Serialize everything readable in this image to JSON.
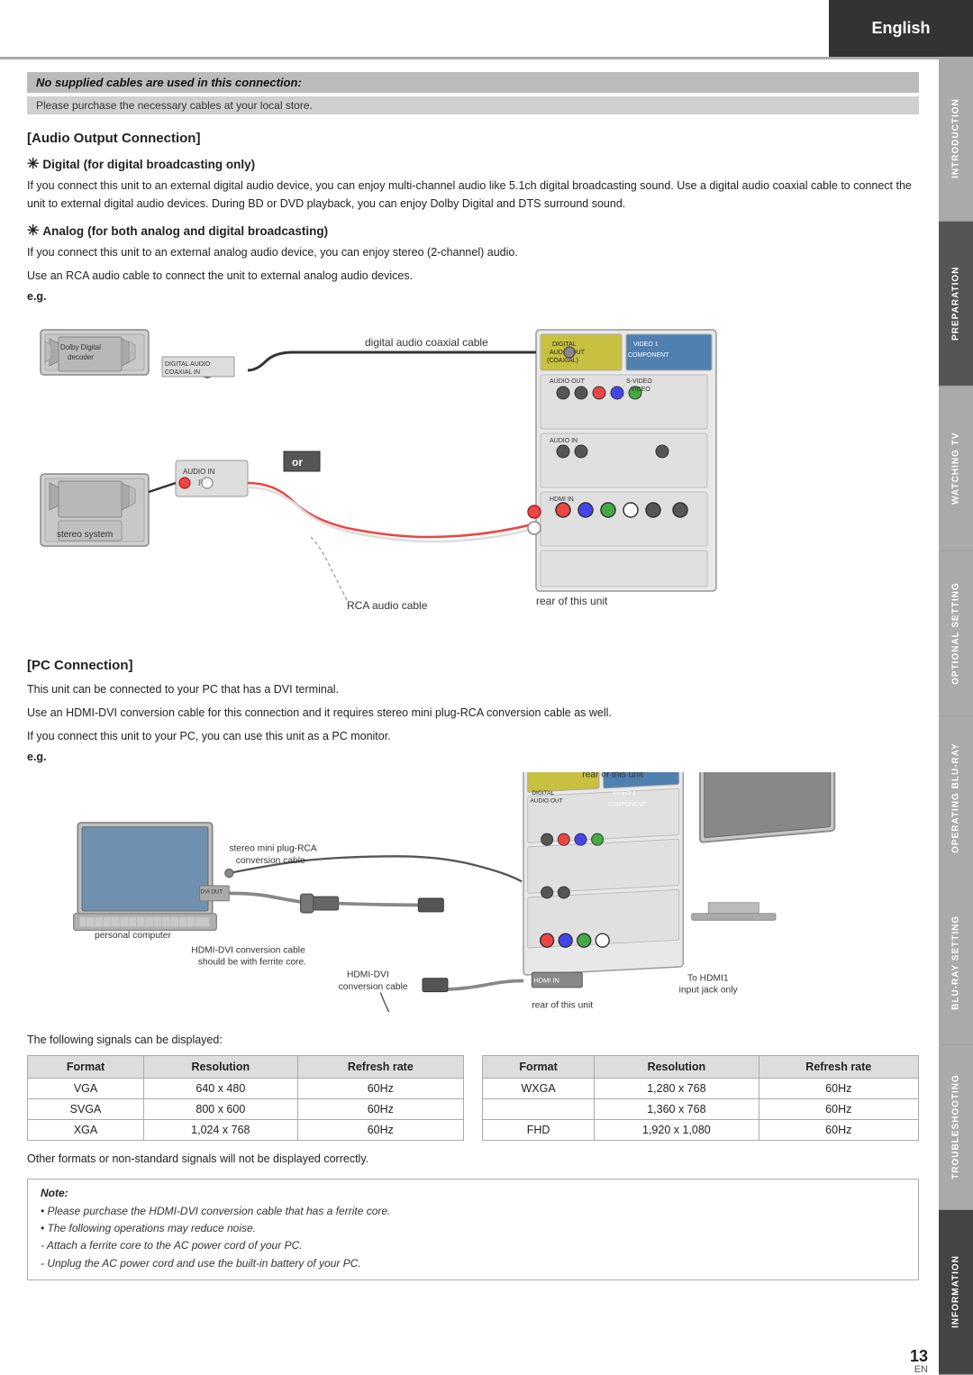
{
  "header": {
    "language": "English"
  },
  "sidebar": {
    "tabs": [
      {
        "label": "INTRODUCTION"
      },
      {
        "label": "PREPARATION",
        "active": true
      },
      {
        "label": "WATCHING TV"
      },
      {
        "label": "OPTIONAL SETTING"
      },
      {
        "label": "OPERATING BLU-RAY"
      },
      {
        "label": "BLU-RAY SETTING"
      },
      {
        "label": "TROUBLESHOOTING"
      },
      {
        "label": "INFORMATION"
      }
    ]
  },
  "notice": {
    "title": "No supplied cables are used in this connection:",
    "subtitle": "Please purchase the necessary cables at your local store."
  },
  "audio_section": {
    "heading": "[Audio Output Connection]",
    "digital": {
      "label": "Digital",
      "sublabel": "(for digital broadcasting only)",
      "body": "If you connect this unit to an external digital audio device, you can enjoy multi-channel audio like 5.1ch digital broadcasting sound. Use a digital audio coaxial cable to connect the unit to external digital audio devices. During BD or DVD playback, you can enjoy Dolby Digital and DTS surround sound."
    },
    "analog": {
      "label": "Analog",
      "sublabel": "(for both analog and digital broadcasting)",
      "body1": "If you connect this unit to an external analog audio device, you can enjoy stereo (2-channel) audio.",
      "body2": "Use an RCA audio cable to connect the unit to external analog audio devices."
    },
    "eg_label": "e.g.",
    "diagram_labels": {
      "digital_audio_coaxial": "digital audio coaxial cable",
      "dolby_decoder": "Dolby Digital\ndecoder",
      "stereo_system": "stereo system",
      "rear_unit": "rear of this unit",
      "rca_cable": "RCA audio cable",
      "or_label": "or",
      "digital_audio_coaxial_in": "DIGITAL AUDIO\nCOAXIAL  IN",
      "audio_in": "AUDIO IN"
    }
  },
  "pc_section": {
    "heading": "[PC Connection]",
    "body1": "This unit can be connected to your PC that has a DVI terminal.",
    "body2": "Use an HDMI-DVI conversion cable for this connection and it requires stereo mini plug-RCA conversion cable as well.",
    "body3": "If you connect this unit to your PC, you can use this unit as a PC monitor.",
    "eg_label": "e.g.",
    "diagram_labels": {
      "rear_unit": "rear of this unit",
      "stereo_mini": "stereo mini plug-RCA\nconversion cable",
      "personal_computer": "personal computer",
      "hdmi_dvi_label": "HDMI-DVI\nconversion cable",
      "hdmi_dvi_ferrite": "HDMI-DVI conversion cable\nshould be with ferrite core.",
      "dvi_out": "DVI OUT",
      "to_hdmi1": "To HDMI1\ninput jack only"
    }
  },
  "signals_text": "The following signals can be displayed:",
  "table1": {
    "headers": [
      "Format",
      "Resolution",
      "Refresh rate"
    ],
    "rows": [
      [
        "VGA",
        "640 x 480",
        "60Hz"
      ],
      [
        "SVGA",
        "800 x 600",
        "60Hz"
      ],
      [
        "XGA",
        "1,024 x 768",
        "60Hz"
      ]
    ]
  },
  "table2": {
    "headers": [
      "Format",
      "Resolution",
      "Refresh rate"
    ],
    "rows": [
      [
        "WXGA",
        "1,280 x 768",
        "60Hz"
      ],
      [
        "",
        "1,360 x 768",
        "60Hz"
      ],
      [
        "FHD",
        "1,920 x 1,080",
        "60Hz"
      ]
    ]
  },
  "other_formats_text": "Other formats or non-standard signals will not be displayed correctly.",
  "note": {
    "title": "Note:",
    "lines": [
      "• Please purchase the HDMI-DVI conversion cable that has a ferrite core.",
      "• The following operations may reduce noise.",
      "  - Attach a ferrite core to the AC power cord of your PC.",
      "  - Unplug the AC power cord and use the built-in battery of your PC."
    ]
  },
  "page_number": "13",
  "page_lang": "EN"
}
